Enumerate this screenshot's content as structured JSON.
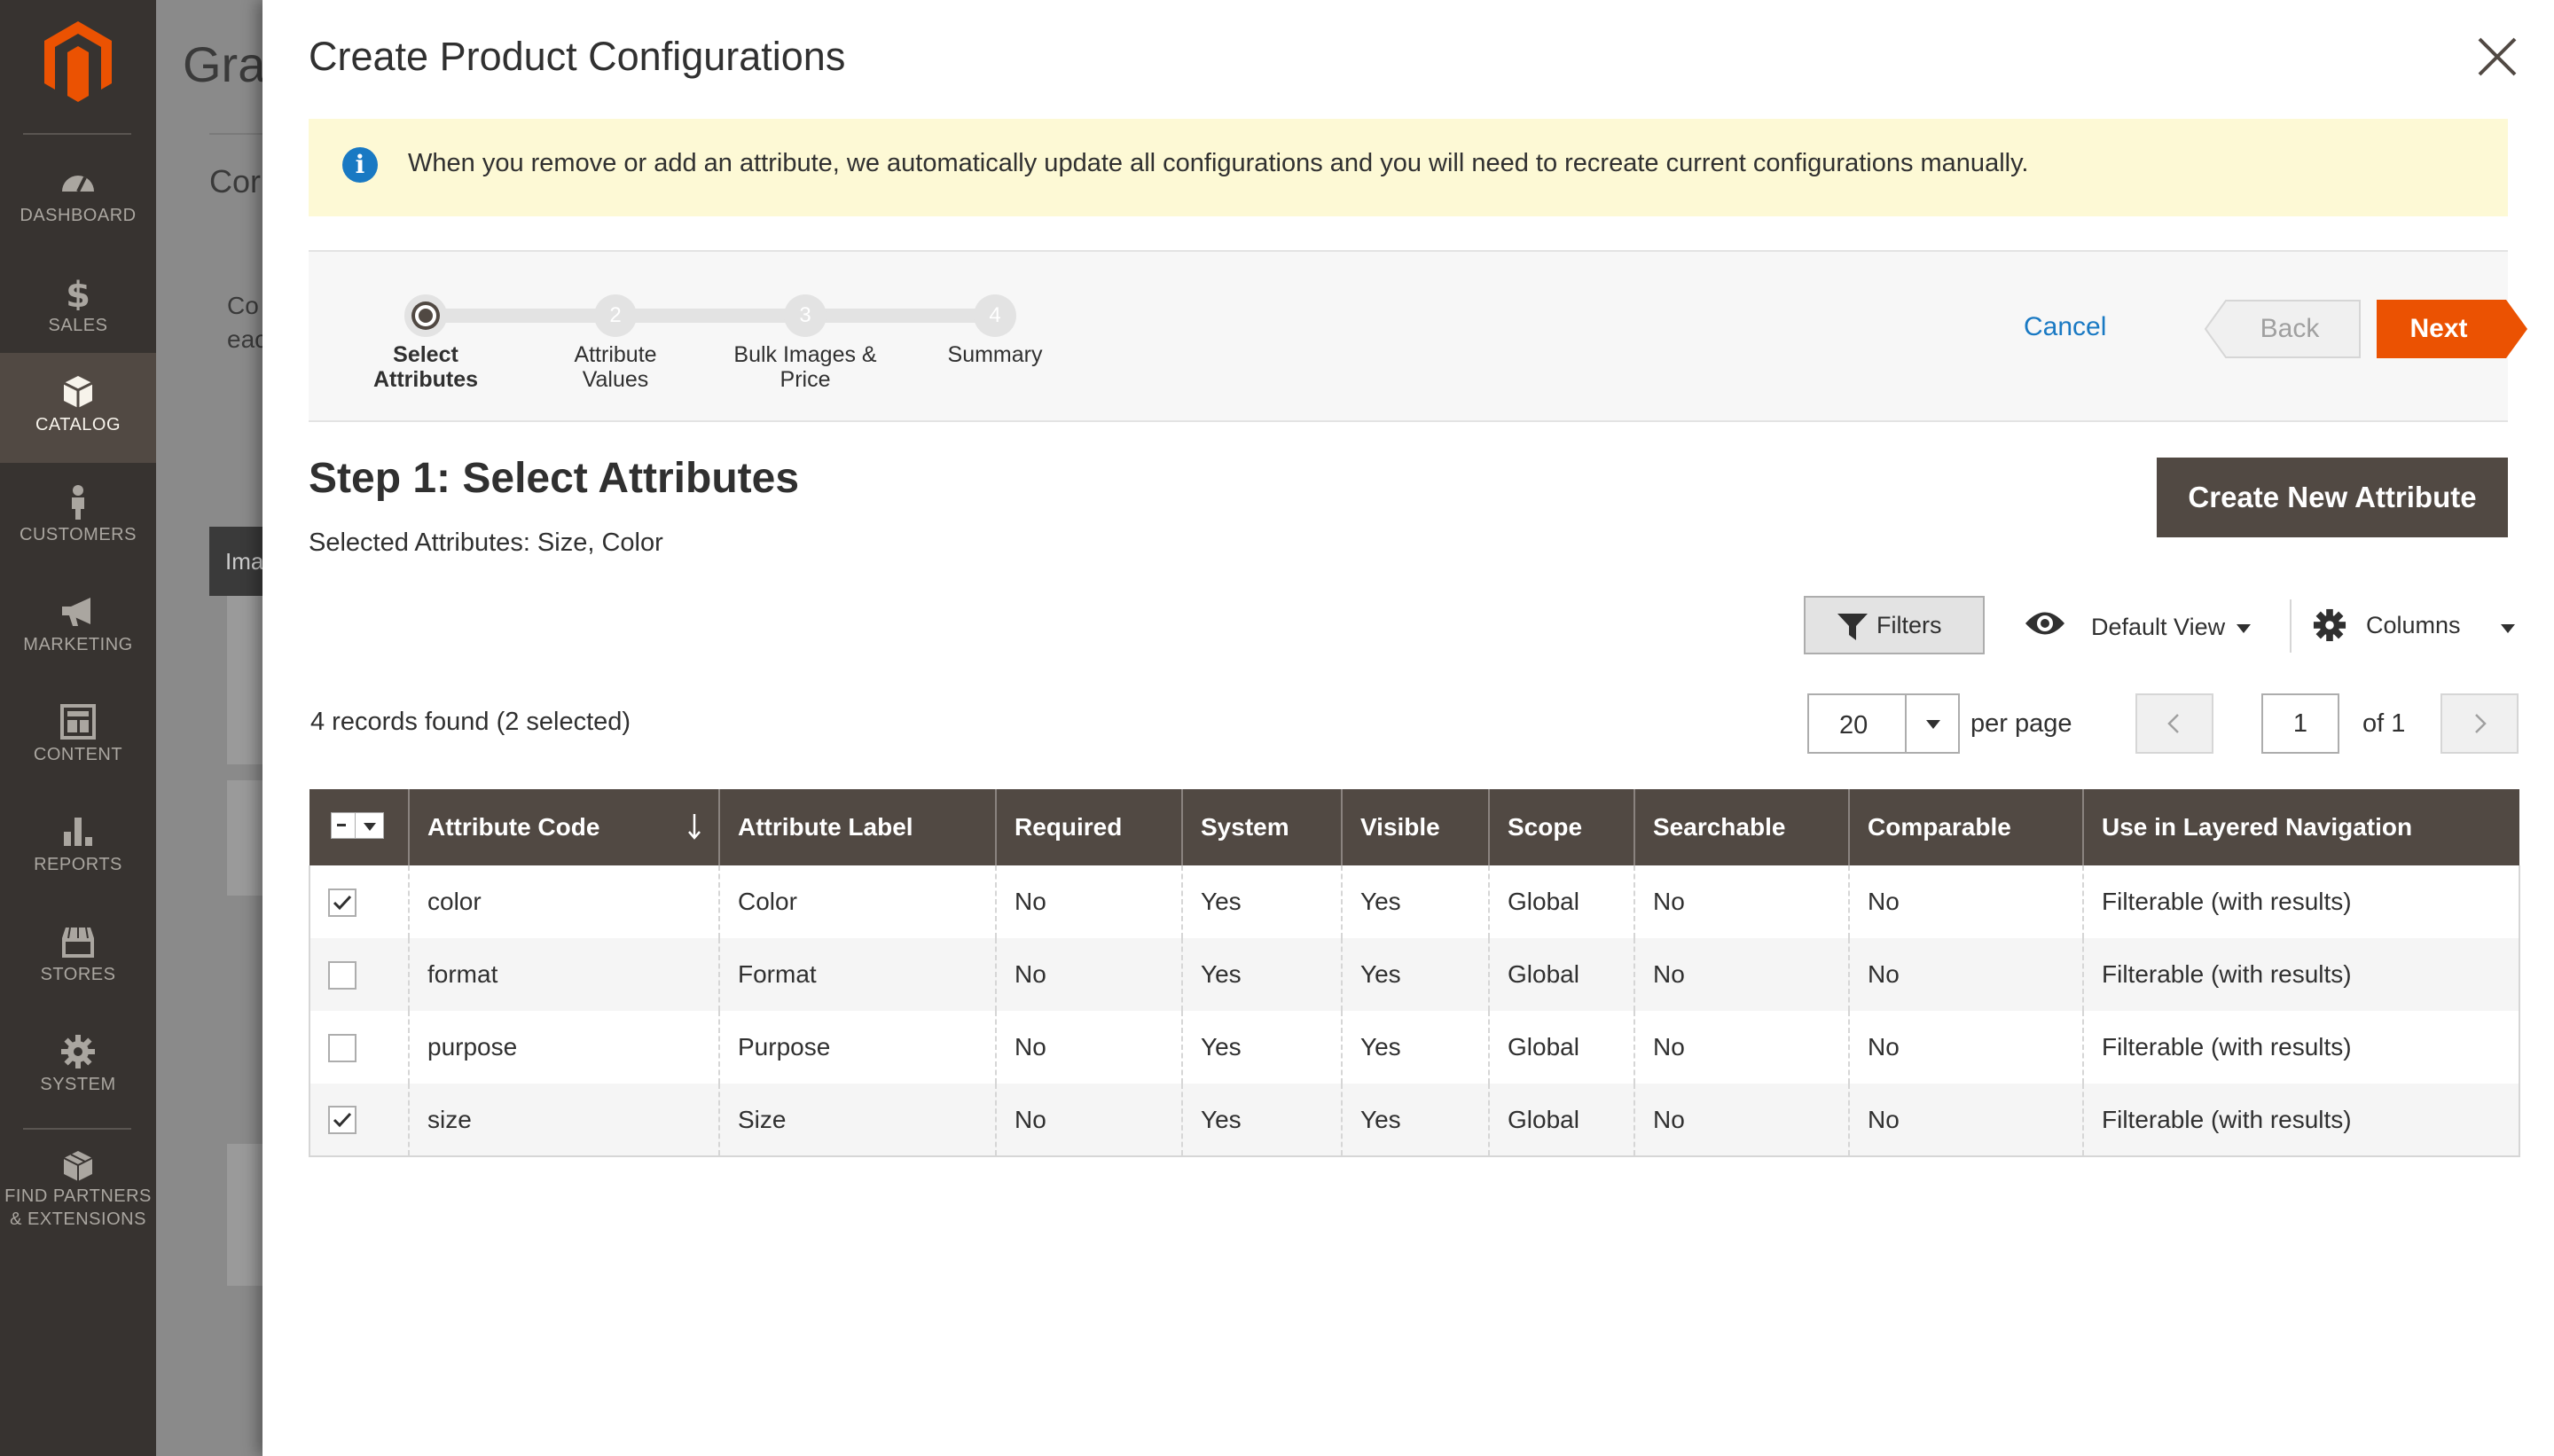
{
  "sidebar": {
    "items": [
      {
        "label": "DASHBOARD",
        "icon": "dashboard-icon"
      },
      {
        "label": "SALES",
        "icon": "dollar-icon"
      },
      {
        "label": "CATALOG",
        "icon": "cube-icon",
        "active": true
      },
      {
        "label": "CUSTOMERS",
        "icon": "person-icon"
      },
      {
        "label": "MARKETING",
        "icon": "megaphone-icon"
      },
      {
        "label": "CONTENT",
        "icon": "content-layout-icon"
      },
      {
        "label": "REPORTS",
        "icon": "bar-chart-icon"
      },
      {
        "label": "STORES",
        "icon": "storefront-icon"
      },
      {
        "label": "SYSTEM",
        "icon": "gear-icon"
      },
      {
        "label_line1": "FIND PARTNERS",
        "label_line2": "& EXTENSIONS",
        "icon": "partners-box-icon"
      }
    ]
  },
  "background_page": {
    "title_fragment": "Gra",
    "subtitle_fragment": "Cor",
    "line1_fragment": "Co",
    "line2_fragment": "eac",
    "table_head_fragment": "Ima"
  },
  "modal": {
    "title": "Create Product Configurations",
    "notice": "When you remove or add an attribute, we automatically update all configurations and you will need to recreate current configurations manually.",
    "wizard": {
      "steps": [
        {
          "number": "1",
          "line1": "Select",
          "line2": "Attributes",
          "current": true
        },
        {
          "number": "2",
          "line1": "Attribute",
          "line2": "Values"
        },
        {
          "number": "3",
          "line1": "Bulk Images &",
          "line2": "Price"
        },
        {
          "number": "4",
          "line1": "Summary",
          "line2": ""
        }
      ],
      "cancel_label": "Cancel",
      "back_label": "Back",
      "next_label": "Next"
    },
    "step_title": "Step 1: Select Attributes",
    "selected_attributes": "Selected Attributes: Size, Color",
    "create_attribute_label": "Create New Attribute",
    "toolbar": {
      "filters_label": "Filters",
      "view_label": "Default View",
      "columns_label": "Columns"
    },
    "records_found": "4 records found (2 selected)",
    "pagination": {
      "per_page_value": "20",
      "per_page_label": "per page",
      "current_page": "1",
      "of_label": "of 1"
    },
    "grid": {
      "columns": [
        "Attribute Code",
        "Attribute Label",
        "Required",
        "System",
        "Visible",
        "Scope",
        "Searchable",
        "Comparable",
        "Use in Layered Navigation"
      ],
      "rows": [
        {
          "checked": true,
          "cells": [
            "color",
            "Color",
            "No",
            "Yes",
            "Yes",
            "Global",
            "No",
            "No",
            "Filterable (with results)"
          ]
        },
        {
          "checked": false,
          "cells": [
            "format",
            "Format",
            "No",
            "Yes",
            "Yes",
            "Global",
            "No",
            "No",
            "Filterable (with results)"
          ]
        },
        {
          "checked": false,
          "cells": [
            "purpose",
            "Purpose",
            "No",
            "Yes",
            "Yes",
            "Global",
            "No",
            "No",
            "Filterable (with results)"
          ]
        },
        {
          "checked": true,
          "cells": [
            "size",
            "Size",
            "No",
            "Yes",
            "Yes",
            "Global",
            "No",
            "No",
            "Filterable (with results)"
          ]
        }
      ]
    }
  },
  "colors": {
    "sidebar_bg": "#373330",
    "sidebar_active": "#514943",
    "brand_orange": "#eb5202",
    "link_blue": "#1979c3",
    "notice_bg": "#fdf9d5",
    "grid_header": "#514943"
  }
}
